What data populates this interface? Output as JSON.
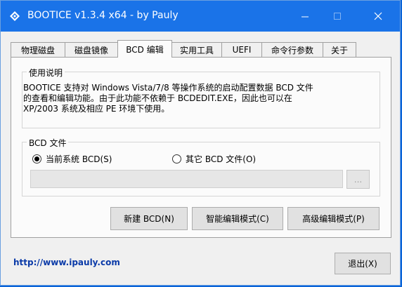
{
  "window": {
    "title": "BOOTICE v1.3.4 x64 - by Pauly",
    "minimize_icon": "minimize-icon",
    "maximize_icon": "maximize-icon",
    "close_icon": "close-icon"
  },
  "tabs": [
    {
      "label": "物理磁盘"
    },
    {
      "label": "磁盘镜像"
    },
    {
      "label": "BCD 编辑"
    },
    {
      "label": "实用工具"
    },
    {
      "label": "UEFI"
    },
    {
      "label": "命令行参数"
    },
    {
      "label": "关于"
    }
  ],
  "active_tab": "BCD 编辑",
  "usage": {
    "title": "使用说明",
    "lines": [
      "BOOTICE 支持对 Windows Vista/7/8 等操作系统的启动配置数据 BCD 文件",
      "的查看和编辑功能。由于此功能不依赖于 BCDEDIT.EXE，因此也可以在",
      "XP/2003 系统及相应 PE 环境下使用。"
    ]
  },
  "bcd_file": {
    "title": "BCD 文件",
    "option_current": "当前系统 BCD(S)",
    "option_other": "其它 BCD 文件(O)",
    "selected": "当前系统 BCD(S)",
    "path_value": "",
    "browse_label": "..."
  },
  "buttons": {
    "new_bcd": "新建 BCD(N)",
    "smart_edit": "智能编辑模式(C)",
    "advanced_edit": "高级编辑模式(P)",
    "exit": "退出(X)"
  },
  "footer": {
    "link": "http://www.ipauly.com"
  },
  "colors": {
    "titlebar": "#1a73e8",
    "window_bg": "#f0f0f0",
    "link": "#0a3aa8"
  }
}
